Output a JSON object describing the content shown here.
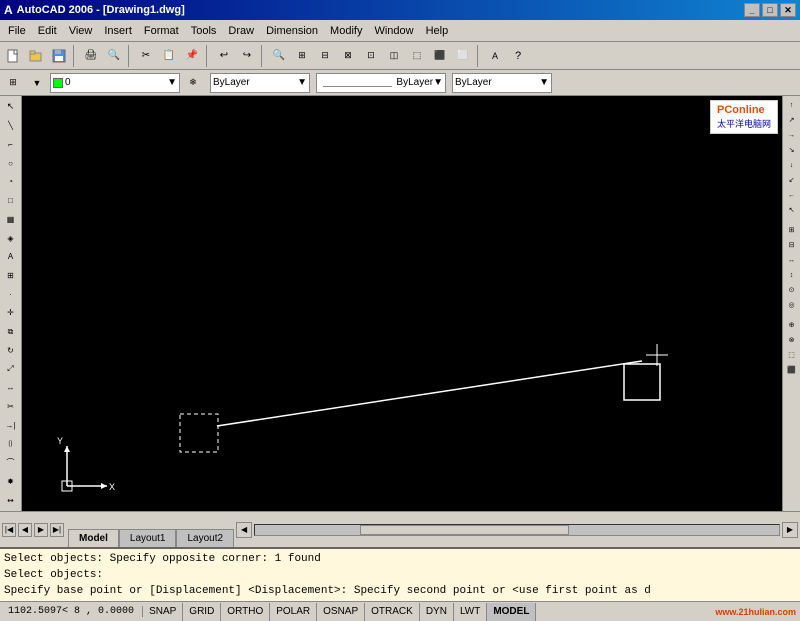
{
  "titlebar": {
    "title": "AutoCAD 2006 - [Drawing1.dwg]",
    "min_label": "_",
    "max_label": "□",
    "close_label": "✕"
  },
  "menubar": {
    "items": [
      "File",
      "Edit",
      "View",
      "Insert",
      "Format",
      "Tools",
      "Draw",
      "Dimension",
      "Modify",
      "Window",
      "Help"
    ]
  },
  "toolbar2": {
    "layer_text": "0",
    "bylayer1": "ByLayer",
    "bylayer2": "ByLayer",
    "bylayer3": "ByLayer"
  },
  "tabs": [
    {
      "label": "Model",
      "active": true
    },
    {
      "label": "Layout1",
      "active": false
    },
    {
      "label": "Layout2",
      "active": false
    }
  ],
  "commandline": {
    "line1": "Select objects: Specify opposite corner: 1 found",
    "line2": "Select objects:",
    "line3": "Specify base point or [Displacement] <Displacement>: Specify second point or <use first point as d"
  },
  "statusbar": {
    "coords": "1102.5097< 8",
    "coords2": "0.0000",
    "snap": "SNAP",
    "grid": "GRID",
    "ortho": "ORTHO",
    "polar": "POLAR",
    "osnap": "OSNAP",
    "otrack": "OTRACK",
    "dyn": "DYN",
    "lwt": "LWT",
    "model": "MODEL"
  },
  "watermark": {
    "line1": "PConline",
    "line2": "太平洋电脑网",
    "line3": "www.21hulian.com"
  },
  "toolbar_icons": {
    "new": "□",
    "open": "📂",
    "save": "💾",
    "print": "🖨",
    "undo": "↩",
    "redo": "↪"
  }
}
